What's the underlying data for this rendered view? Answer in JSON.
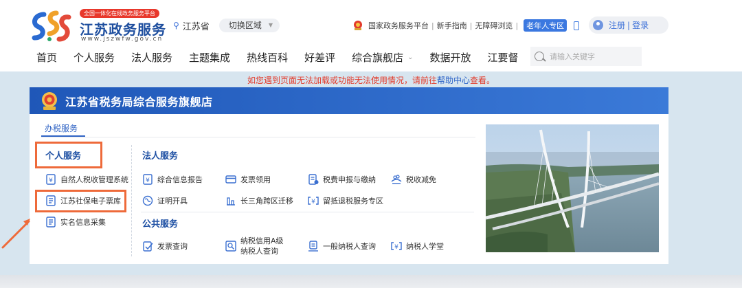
{
  "header": {
    "logo": {
      "badge": "全国一体化在线政务服务平台",
      "title": "江苏政务服务",
      "url": "www.jszwfw.gov.cn"
    },
    "region": {
      "current": "江苏省",
      "switch_label": "切换区域"
    },
    "quicklinks": {
      "national": "国家政务服务平台",
      "guide": "新手指南",
      "accessible": "无障碍浏览",
      "senior": "老年人专区"
    },
    "auth": {
      "register": "注册",
      "login": "登录"
    },
    "nav": [
      "首页",
      "个人服务",
      "法人服务",
      "主题集成",
      "热线百科",
      "好差评",
      "综合旗舰店",
      "数据开放",
      "江要督"
    ],
    "search": {
      "placeholder": "请输入关键字"
    }
  },
  "notice": {
    "prefix": "如您遇到页面无法加载或功能无法使用情况，请前往",
    "link": "帮助中心",
    "suffix": "查看。"
  },
  "store": {
    "title": "江苏省税务局综合服务旗舰店",
    "tab": "办税服务",
    "personal": {
      "title": "个人服务",
      "items": [
        "自然人税收管理系统",
        "江苏社保电子票库",
        "实名信息采集"
      ]
    },
    "corporate": {
      "title": "法人服务",
      "items": [
        "综合信息报告",
        "发票领用",
        "税费申报与缴纳",
        "税收减免",
        "证明开具",
        "长三角跨区迁移",
        "留抵退税服务专区"
      ]
    },
    "public": {
      "title": "公共服务",
      "items": [
        "发票查询",
        "纳税信用A级纳税人查询",
        "一般纳税人查询",
        "纳税人学堂"
      ]
    }
  },
  "colors": {
    "brand_blue": "#1f57b8",
    "highlight_orange": "#ee6a3a",
    "notice_red": "#e23b2b",
    "page_bg": "#d7e5ef"
  }
}
